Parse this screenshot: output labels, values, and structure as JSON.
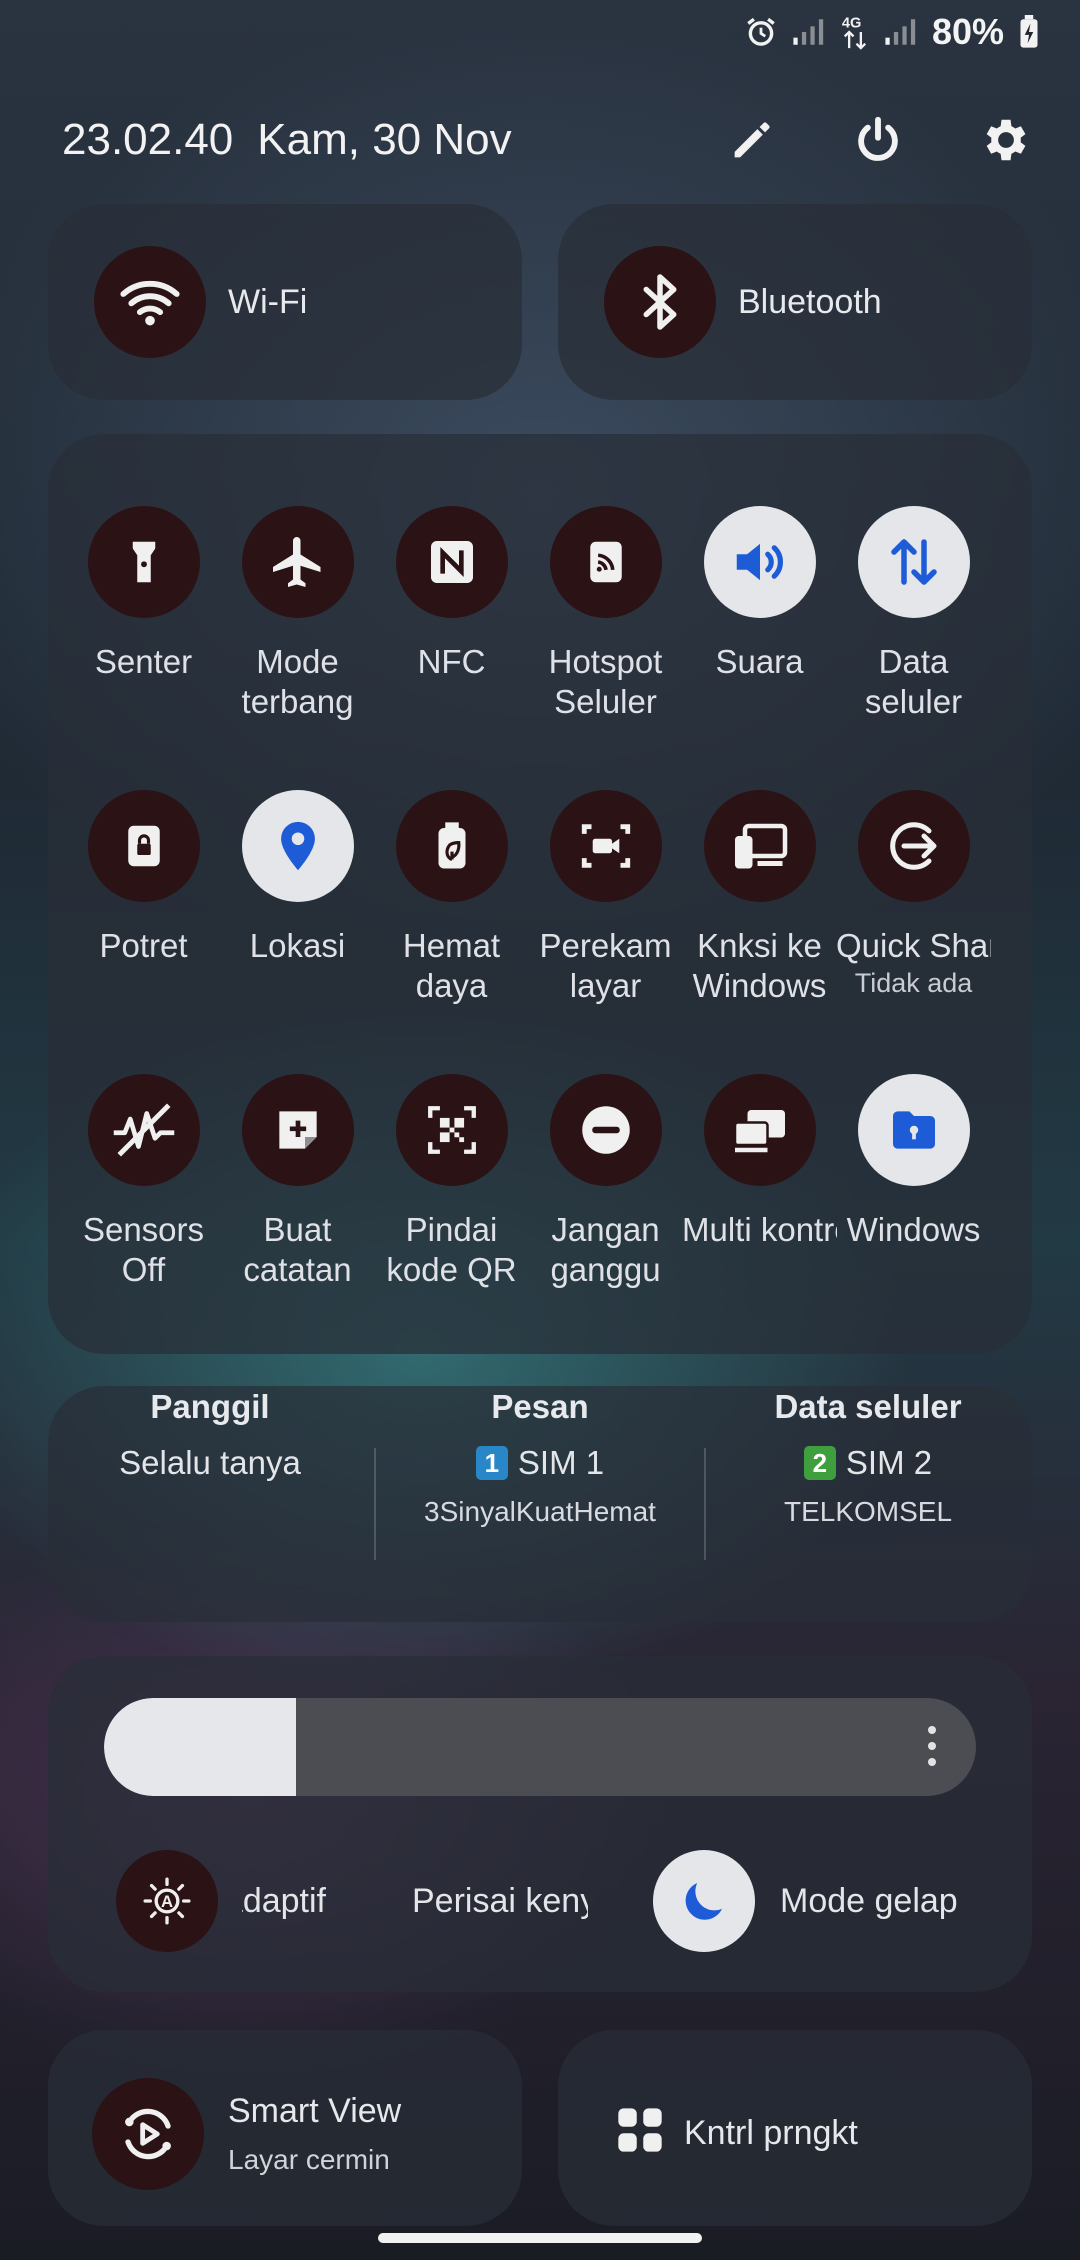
{
  "status_bar": {
    "battery_percent": "80%",
    "icons": [
      "alarm-icon",
      "signal-1-icon",
      "4g-icon",
      "signal-2-icon",
      "battery-charging-icon"
    ]
  },
  "header": {
    "time": "23.02.40",
    "date": "Kam, 30 Nov",
    "actions": [
      "edit-icon",
      "power-icon",
      "settings-icon"
    ]
  },
  "top_tiles": {
    "wifi": "Wi-Fi",
    "bluetooth": "Bluetooth"
  },
  "quick_tiles": [
    {
      "label": "Senter",
      "on": false,
      "icon": "flashlight-icon"
    },
    {
      "label": "Mode\nterbang",
      "on": false,
      "icon": "airplane-icon"
    },
    {
      "label": "NFC",
      "on": false,
      "icon": "nfc-icon"
    },
    {
      "label": "Hotspot\nSeluler",
      "on": false,
      "icon": "hotspot-icon"
    },
    {
      "label": "Suara",
      "on": true,
      "icon": "sound-icon"
    },
    {
      "label": "Data\nseluler",
      "on": true,
      "icon": "mobile-data-icon"
    },
    {
      "label": "Potret",
      "on": false,
      "icon": "portrait-lock-icon"
    },
    {
      "label": "Lokasi",
      "on": true,
      "icon": "location-icon"
    },
    {
      "label": "Hemat\ndaya",
      "on": false,
      "icon": "power-saving-icon"
    },
    {
      "label": "Perekam\nlayar",
      "on": false,
      "icon": "screen-recorder-icon"
    },
    {
      "label": "Knksi ke\nWindows",
      "on": false,
      "icon": "link-to-windows-icon"
    },
    {
      "label": "Quick Share",
      "sub": "Tidak ada",
      "on": false,
      "icon": "quick-share-icon"
    },
    {
      "label": "Sensors\nOff",
      "on": false,
      "icon": "sensors-off-icon"
    },
    {
      "label": "Buat\ncatatan",
      "on": false,
      "icon": "create-note-icon"
    },
    {
      "label": "Pindai\nkode QR",
      "on": false,
      "icon": "qr-scan-icon"
    },
    {
      "label": "Jangan\nganggu",
      "on": false,
      "icon": "do-not-disturb-icon"
    },
    {
      "label": "Multi kontrol",
      "on": false,
      "icon": "multi-control-icon"
    },
    {
      "label": "Windows",
      "on": true,
      "icon": "secure-folder-icon"
    }
  ],
  "sim": {
    "call": {
      "title": "Panggil",
      "value": "Selalu tanya"
    },
    "message": {
      "title": "Pesan",
      "badge": "1",
      "sim": "SIM 1",
      "carrier": "3SinyalKuatHemat",
      "badge_color": "#2a87c7"
    },
    "data": {
      "title": "Data seluler",
      "badge": "2",
      "sim": "SIM 2",
      "carrier": "TELKOMSEL",
      "badge_color": "#3f9f3f"
    }
  },
  "brightness": {
    "level": 0.22,
    "extra_dim_label": "Kecerahan adaptif",
    "eye_comfort_label": "Perisai kenyamanan mata",
    "dark_mode_label": "Mode gelap"
  },
  "bottom_tiles": {
    "smart_view_title": "Smart View",
    "smart_view_sub": "Layar cermin",
    "devices_label": "Kntrl prngkt"
  },
  "colors": {
    "tile_off": "#2b1214",
    "tile_on": "#e4e6ea",
    "accent_blue": "#1e5bd6"
  }
}
